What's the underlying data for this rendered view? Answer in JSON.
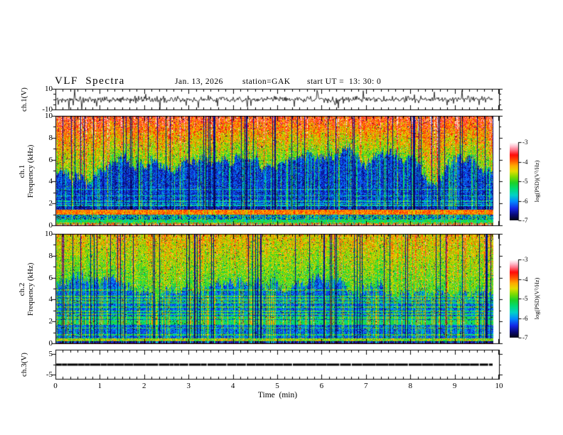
{
  "header": {
    "title": "VLF  Spectra",
    "date": "Jan. 13, 2026",
    "station": "station=GAK",
    "start_ut": "start UT =  13: 30: 0"
  },
  "x_axis": {
    "label": "Time  (min)",
    "lim": [
      0,
      10
    ],
    "ticks": [
      0,
      1,
      2,
      3,
      4,
      5,
      6,
      7,
      8,
      9,
      10
    ],
    "minor_divisions": 6,
    "data_end_min": 9.85
  },
  "colormap": {
    "stops": [
      [
        0.0,
        5,
        5,
        25
      ],
      [
        0.07,
        10,
        10,
        120
      ],
      [
        0.15,
        20,
        40,
        230
      ],
      [
        0.24,
        0,
        140,
        255
      ],
      [
        0.32,
        0,
        210,
        200
      ],
      [
        0.4,
        0,
        220,
        120
      ],
      [
        0.48,
        30,
        210,
        40
      ],
      [
        0.56,
        130,
        220,
        0
      ],
      [
        0.63,
        230,
        220,
        0
      ],
      [
        0.7,
        255,
        170,
        0
      ],
      [
        0.77,
        255,
        80,
        0
      ],
      [
        0.84,
        255,
        10,
        10
      ],
      [
        0.9,
        255,
        110,
        130
      ],
      [
        0.95,
        255,
        190,
        205
      ],
      [
        1.0,
        255,
        255,
        255
      ]
    ]
  },
  "chart_data": [
    {
      "type": "line",
      "panel": "ch1-waveform",
      "ylabel": "ch.1(V)",
      "ylim": [
        -10,
        10
      ],
      "yticks": [
        {
          "value": 10,
          "label": "10"
        },
        {
          "value": -10,
          "label": "-10"
        }
      ],
      "yticks_minor": [
        5,
        0,
        -5
      ],
      "signal": {
        "kind": "noise-with-spikes",
        "std_v": 1.4,
        "spike_prob": 0.05,
        "spike_min_v": 2.5,
        "spike_max_v": 9,
        "seed": 20260113,
        "color": "#000000"
      }
    },
    {
      "type": "heatmap",
      "panel": "ch1-spectrogram",
      "ylabel_lines": [
        "ch.1",
        "Frequency  (kHz)"
      ],
      "ylim": [
        0,
        10
      ],
      "yticks": [
        {
          "value": 0,
          "label": "0"
        },
        {
          "value": 2,
          "label": "2"
        },
        {
          "value": 4,
          "label": "4"
        },
        {
          "value": 6,
          "label": "6"
        },
        {
          "value": 8,
          "label": "8"
        },
        {
          "value": 10,
          "label": "10"
        }
      ],
      "yticks_minor": [
        1,
        3,
        5,
        7,
        9
      ],
      "colorbar": {
        "label": "log(PSD)(V²/Hz)",
        "lim": [
          -7,
          -3
        ],
        "ticks": [
          -3,
          -4,
          -5,
          -6,
          -7
        ]
      },
      "texture": {
        "seed": 11,
        "boundary_khz": {
          "base": 5.3,
          "wander": 1.4
        },
        "warm": {
          "base": 0.52,
          "top_boost": 0.3,
          "noise": 0.14
        },
        "cold": {
          "base": 0.16,
          "noise": 0.1
        },
        "dark_col_prob": 0.1,
        "bright_col_prob": 0.14,
        "hot_col_prob": 0.1,
        "bands": [
          {
            "f0": 1.5,
            "f1": 1.8,
            "base": 0.12,
            "noise": 0.1
          },
          {
            "f0": 1.05,
            "f1": 1.5,
            "base": 0.74,
            "noise": 0.1
          },
          {
            "f0": 0.55,
            "f1": 1.05,
            "base": 0.28,
            "noise": 0.26
          },
          {
            "f0": 0.32,
            "f1": 0.55,
            "base": 0.44,
            "noise": 0.1
          },
          {
            "f0": 0.1,
            "f1": 0.32,
            "base": 0.6,
            "noise": 0.3
          },
          {
            "f0": 0.0,
            "f1": 0.1,
            "base": 0.92,
            "noise": 0.08
          }
        ],
        "h_lines": {
          "count": 6,
          "fmin": 1.8,
          "fmax": 3.4,
          "boost": 0.16
        }
      }
    },
    {
      "type": "heatmap",
      "panel": "ch2-spectrogram",
      "ylabel_lines": [
        "ch.2",
        "Frequency  (kHz)"
      ],
      "ylim": [
        0,
        10
      ],
      "yticks": [
        {
          "value": 0,
          "label": "0"
        },
        {
          "value": 2,
          "label": "2"
        },
        {
          "value": 4,
          "label": "4"
        },
        {
          "value": 6,
          "label": "6"
        },
        {
          "value": 8,
          "label": "8"
        },
        {
          "value": 10,
          "label": "10"
        }
      ],
      "yticks_minor": [
        1,
        3,
        5,
        7,
        9
      ],
      "colorbar": {
        "label": "log(PSD)(V²/Hz)",
        "lim": [
          -7,
          -3
        ],
        "ticks": [
          -3,
          -4,
          -5,
          -6,
          -7
        ]
      },
      "texture": {
        "seed": 77,
        "boundary_khz": {
          "base": 5.0,
          "wander": 1.1
        },
        "warm": {
          "base": 0.5,
          "top_boost": 0.16,
          "noise": 0.13
        },
        "cold": {
          "base": 0.2,
          "noise": 0.09
        },
        "dark_col_prob": 0.08,
        "bright_col_prob": 0.2,
        "hot_col_prob": 0.07,
        "bands": [
          {
            "f0": 0.25,
            "f1": 0.5,
            "base": 0.58,
            "noise": 0.18
          },
          {
            "f0": 0.05,
            "f1": 0.25,
            "base": 0.1,
            "noise": 0.06
          },
          {
            "f0": 0.0,
            "f1": 0.05,
            "base": 0.8,
            "noise": 0.05
          }
        ],
        "h_lines": {
          "count": 26,
          "fmin": 0.6,
          "fmax": 5.0,
          "boost": 0.22
        }
      }
    },
    {
      "type": "line",
      "panel": "ch3-waveform",
      "ylabel": "ch.3(V)",
      "ylim": [
        -7,
        7
      ],
      "yticks": [
        {
          "value": 5,
          "label": "5"
        },
        {
          "value": -5,
          "label": "-5"
        }
      ],
      "yticks_minor": [
        0
      ],
      "signal": {
        "kind": "flat",
        "value_v": 0,
        "thickness_px": 3,
        "seed": 9,
        "color": "#000000"
      }
    }
  ]
}
